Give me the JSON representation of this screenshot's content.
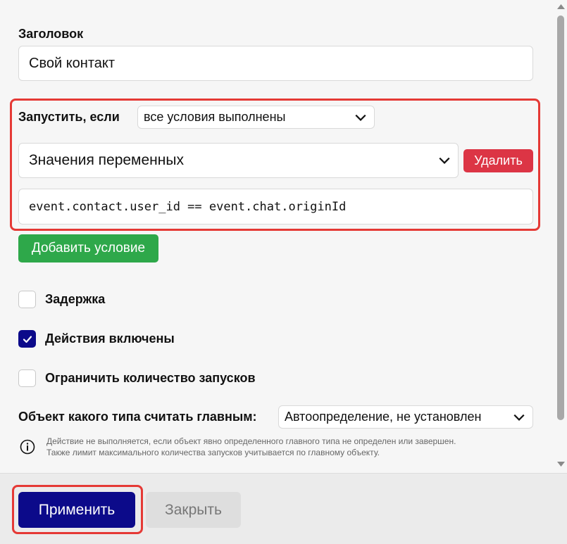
{
  "form": {
    "title_label": "Заголовок",
    "title_value": "Свой контакт",
    "run_if_label": "Запустить, если",
    "run_if_selected": "все условия выполнены",
    "condition_type_selected": "Значения переменных",
    "delete_label": "Удалить",
    "expression_value": "event.contact.user_id == event.chat.originId",
    "add_condition_label": "Добавить условие",
    "checkboxes": [
      {
        "label": "Задержка",
        "checked": false
      },
      {
        "label": "Действия включены",
        "checked": true
      },
      {
        "label": "Ограничить количество запусков",
        "checked": false
      }
    ],
    "main_type_label": "Объект какого типа считать главным:",
    "main_type_selected": "Автоопределение, не установлен",
    "info_line1": "Действие не выполняется, если объект явно определенного главного типа не определен или завершен.",
    "info_line2": "Также лимит максимального количества запусков учитывается по главному объекту."
  },
  "footer": {
    "apply_label": "Применить",
    "close_label": "Закрыть"
  },
  "icons": {
    "chevron": "chevron-down-icon",
    "check": "check-icon",
    "info": "info-icon"
  },
  "colors": {
    "primary": "#0c0a8a",
    "danger": "#dc3545",
    "success": "#2ea84a",
    "highlight": "#e53935"
  }
}
